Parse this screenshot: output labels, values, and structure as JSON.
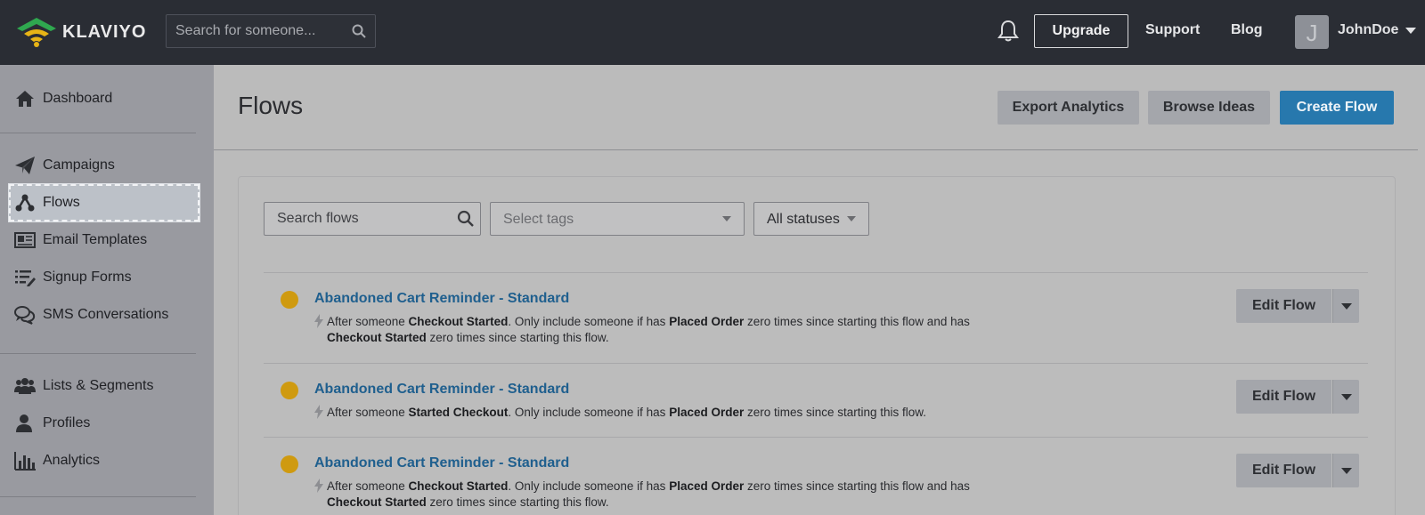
{
  "header": {
    "logo_text": "KLAVIYO",
    "search_placeholder": "Search for someone...",
    "upgrade_label": "Upgrade",
    "support_label": "Support",
    "blog_label": "Blog",
    "avatar_initial": "J",
    "username": "JohnDoe"
  },
  "sidebar": {
    "items": [
      {
        "label": "Dashboard",
        "icon": "home-icon"
      },
      {
        "label": "Campaigns",
        "icon": "paper-plane-icon"
      },
      {
        "label": "Flows",
        "icon": "flows-icon",
        "active": true
      },
      {
        "label": "Email Templates",
        "icon": "newspaper-icon"
      },
      {
        "label": "Signup Forms",
        "icon": "list-edit-icon"
      },
      {
        "label": "SMS Conversations",
        "icon": "chat-bubbles-icon"
      },
      {
        "label": "Lists & Segments",
        "icon": "users-icon"
      },
      {
        "label": "Profiles",
        "icon": "user-icon"
      },
      {
        "label": "Analytics",
        "icon": "bar-chart-icon"
      }
    ]
  },
  "main": {
    "title": "Flows",
    "export_label": "Export Analytics",
    "browse_label": "Browse Ideas",
    "create_label": "Create Flow",
    "filters": {
      "search_placeholder": "Search flows",
      "tags_placeholder": "Select tags",
      "status_value": "All statuses"
    },
    "flows": [
      {
        "name": "Abandoned Cart Reminder - Standard",
        "status_color": "#cf9a10",
        "desc": {
          "t1": "After someone ",
          "b1": "Checkout Started",
          "t2": ". Only include someone if has ",
          "b2": "Placed Order",
          "t3": " zero times since starting this flow and has ",
          "b3": "Checkout Started",
          "t4": " zero times since starting this flow."
        },
        "edit_label": "Edit Flow"
      },
      {
        "name": "Abandoned Cart Reminder - Standard",
        "status_color": "#cf9a10",
        "desc": {
          "t1": "After someone ",
          "b1": "Started Checkout",
          "t2": ". Only include someone if has ",
          "b2": "Placed Order",
          "t3": " zero times since starting this flow."
        },
        "edit_label": "Edit Flow"
      },
      {
        "name": "Abandoned Cart Reminder - Standard",
        "status_color": "#cf9a10",
        "desc": {
          "t1": "After someone ",
          "b1": "Checkout Started",
          "t2": ". Only include someone if has ",
          "b2": "Placed Order",
          "t3": " zero times since starting this flow and has ",
          "b3": "Checkout Started",
          "t4": " zero times since starting this flow."
        },
        "edit_label": "Edit Flow"
      }
    ]
  }
}
